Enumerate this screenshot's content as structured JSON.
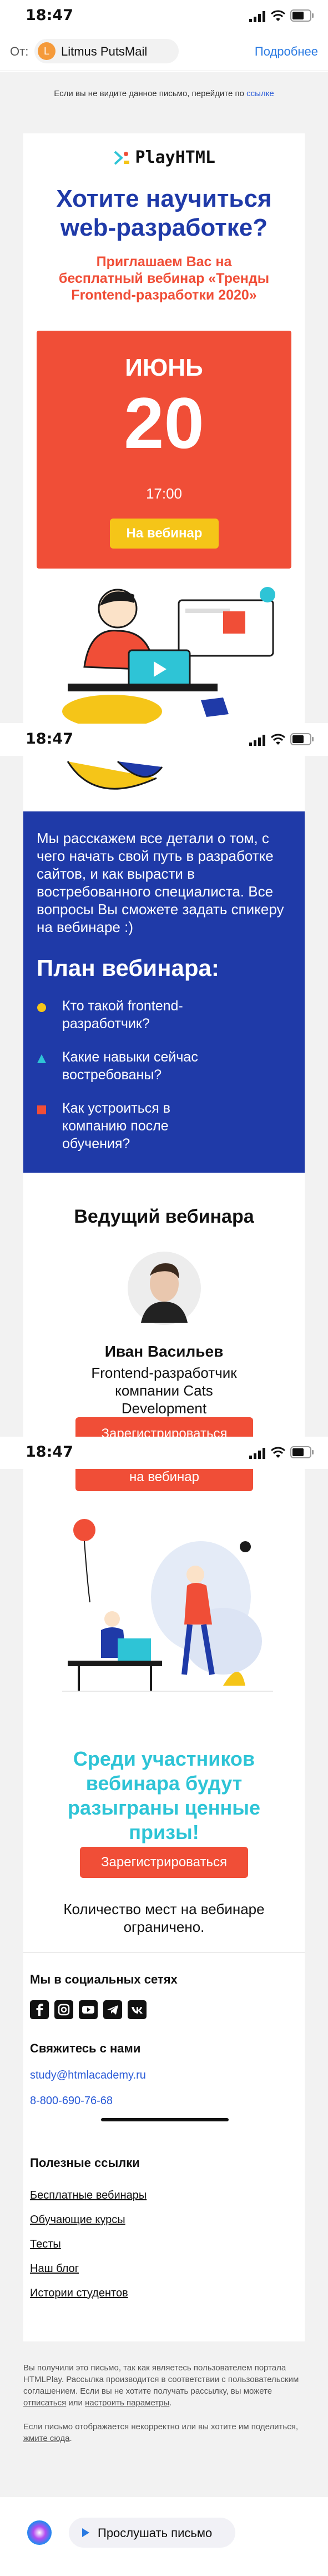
{
  "status_time": "18:47",
  "mail_header": {
    "from_label": "От:",
    "sender_initial": "L",
    "sender_name": "Litmus PutsMail",
    "details_link": "Подробнее"
  },
  "preheader": {
    "text": "Если вы не видите данное письмо, перейдите по",
    "link": "ссылке"
  },
  "hero": {
    "logo_text": "PlayHTML",
    "title": "Хотите научиться web-разработке?",
    "subtitle": "Приглашаем Вас на бесплатный вебинар «Тренды Frontend-разработки 2020»",
    "month": "ИЮНЬ",
    "day": "20",
    "time": "17:00",
    "cta": "На вебинар"
  },
  "about": {
    "text": "Мы расскажем все детали о том, с чего начать свой путь в разработке сайтов, и как вырасти в востребованного специалиста. Все вопросы Вы сможете задать спикеру на вебинаре :)",
    "plan_title": "План вебинара:",
    "plan_items": [
      {
        "text": "Кто такой frontend-разработчик?",
        "color": "#f5c518"
      },
      {
        "text": "Какие навыки сейчас востребованы?",
        "color": "#2ec4d6"
      },
      {
        "text": "Как устроиться в компанию после обучения?",
        "color": "#f04e37"
      }
    ]
  },
  "host": {
    "section_title": "Ведущий вебинара",
    "name": "Иван Васильев",
    "role": "Frontend-разработчик компании Cats Development",
    "cta_partial": "Зарегистрироваться",
    "cta_partial2": "на вебинар"
  },
  "prizes": {
    "title": "Среди участников вебинара будут разыграны ценные призы!",
    "cta": "Зарегистрироваться",
    "limited": "Количество мест на вебинаре ограничено."
  },
  "footer": {
    "social_title": "Мы в социальных сетях",
    "contact_title": "Свяжитесь с нами",
    "email": "study@htmlacademy.ru",
    "phone": "8-800-690-76-68",
    "links_title": "Полезные ссылки",
    "links": [
      "Бесплатные вебинары",
      "Обучающие курсы",
      "Тесты",
      "Наш блог",
      "Истории студентов"
    ],
    "legal_1a": "Вы получили это письмо, так как являетесь пользователем портала HTMLPlay. Рассылка производится в соответствии с пользовательским соглашением. Если вы не хотите получать рассылку, вы можете ",
    "unsubscribe": "отписаться",
    "legal_1b": " или ",
    "settings": "настроить параметры",
    "legal_2a": "Если письмо отображается некорректно или вы хотите им поделиться, ",
    "web_version": "жмите сюда"
  },
  "bottom_bar": {
    "listen": "Прослушать письмо"
  },
  "colors": {
    "accent_blue": "#1f3aa8",
    "red": "#f04e37",
    "yellow": "#f5c518",
    "teal": "#2ec4d6",
    "link": "#2a5bd7"
  }
}
